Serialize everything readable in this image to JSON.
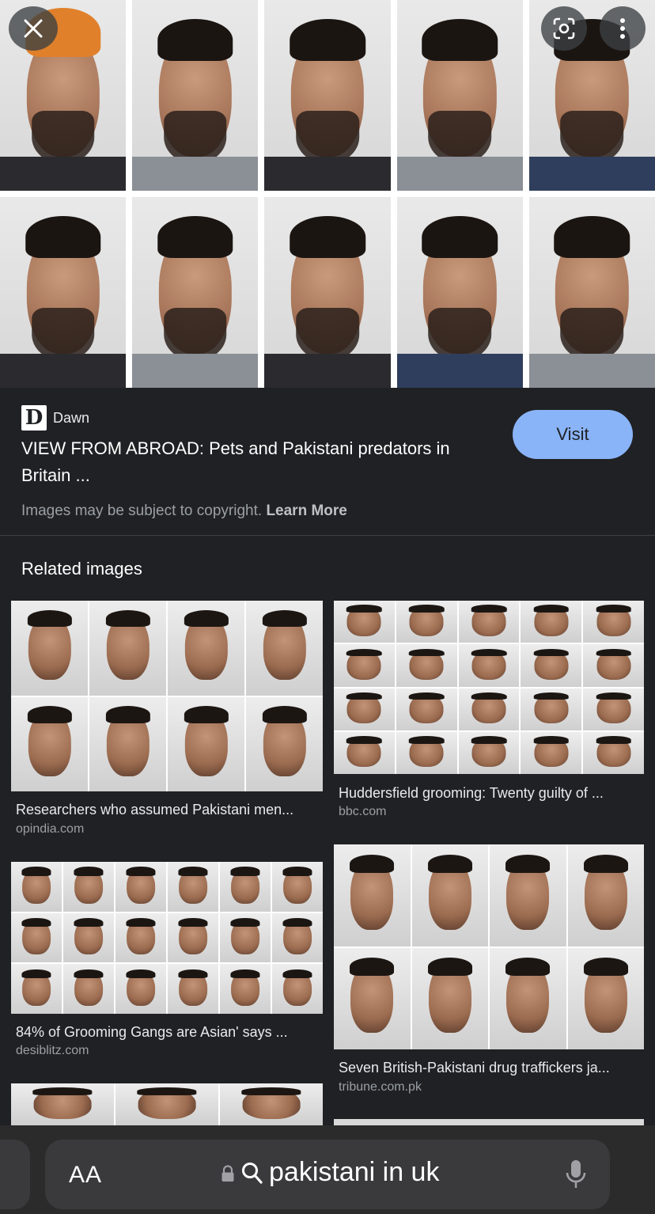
{
  "hero": {
    "faces": [
      {
        "style": "turban"
      },
      {
        "style": "light"
      },
      {
        "style": ""
      },
      {
        "style": "light"
      },
      {
        "style": "blue"
      },
      {
        "style": ""
      },
      {
        "style": "light"
      },
      {
        "style": ""
      },
      {
        "style": "blue"
      },
      {
        "style": "light"
      }
    ],
    "icons": {
      "close": "close-icon",
      "lens": "google-lens-icon",
      "more": "more-vert-icon"
    }
  },
  "result": {
    "source_logo": "D",
    "source_name": "Dawn",
    "title": "VIEW FROM ABROAD: Pets and Pakistani predators in Britain ...",
    "visit_label": "Visit",
    "copyright_text": "Images may be subject to copyright. ",
    "learn_more": "Learn More"
  },
  "related": {
    "heading": "Related images",
    "items": [
      {
        "title": "Researchers who assumed Pakistani men...",
        "source": "opindia.com",
        "cols": 4,
        "rows": 2
      },
      {
        "title": "Huddersfield grooming: Twenty guilty of ...",
        "source": "bbc.com",
        "cols": 5,
        "rows": 4
      },
      {
        "title": "84% of Grooming Gangs are Asian' says ...",
        "source": "desiblitz.com",
        "cols": 6,
        "rows": 3
      },
      {
        "title": "Seven British-Pakistani drug traffickers ja...",
        "source": "tribune.com.pk",
        "cols": 4,
        "rows": 2
      }
    ]
  },
  "browser": {
    "aa_label": "AA",
    "query": "pakistani in uk",
    "icons": {
      "lock": "lock-icon",
      "search": "search-icon",
      "mic": "microphone-icon"
    }
  },
  "colors": {
    "background": "#202124",
    "accent": "#8ab4f8",
    "muted": "#9aa0a6"
  }
}
